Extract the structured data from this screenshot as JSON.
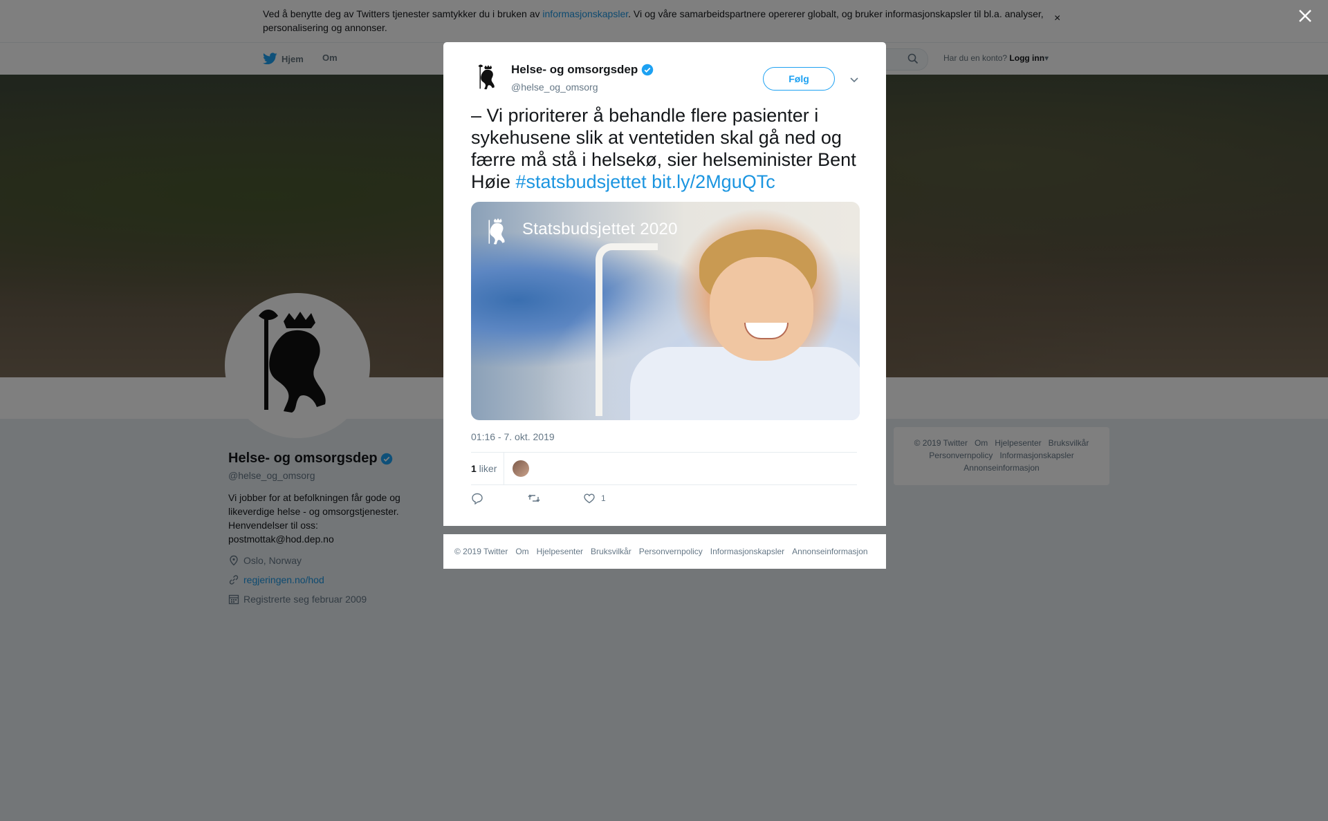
{
  "cookie_banner": {
    "text_before": "Ved å benytte deg av Twitters tjenester samtykker du i bruken av ",
    "link": "informasjonskapsler",
    "text_after": ". Vi og våre samarbeidspartnere opererer globalt, og bruker informasjonskapsler til bl.a. analyser, personalisering og annonser.",
    "close": "×"
  },
  "topnav": {
    "home": "Hjem",
    "about": "Om",
    "account_prompt": "Har du en konto?",
    "login": "Logg inn"
  },
  "profile": {
    "name": "Helse- og omsorgsdep",
    "handle": "@helse_og_omsorg",
    "bio": "Vi jobber for at befolkningen får gode og likeverdige helse - og omsorgstjenester. Henvendelser til oss: postmottak@hod.dep.no",
    "location": "Oslo, Norway",
    "website": "regjeringen.no/hod",
    "joined": "Registrerte seg februar 2009"
  },
  "side_footer": {
    "links_row1": [
      "© 2019 Twitter",
      "Om",
      "Hjelpesenter",
      "Bruksvilkår"
    ],
    "links_row2": [
      "Personvernpolicy",
      "Informasjonskapsler"
    ],
    "links_row3": [
      "Annonseinformasjon"
    ]
  },
  "tweet": {
    "author_name": "Helse- og omsorgsdep",
    "author_handle": "@helse_og_omsorg",
    "follow_label": "Følg",
    "text": "– Vi prioriterer å behandle flere pasienter i sykehusene slik at ventetiden skal gå ned og færre må stå i helsekø, sier helseminister Bent Høie ",
    "hashtag": "#statsbudsjettet",
    "link": "bit.ly/2MguQTc",
    "media_caption": "Statsbudsjettet 2020",
    "timestamp": "01:16 - 7. okt. 2019",
    "likes_count": "1",
    "likes_label": " liker",
    "like_action_count": "1"
  },
  "modal_footer": {
    "links": [
      "© 2019 Twitter",
      "Om",
      "Hjelpesenter",
      "Bruksvilkår",
      "Personvernpolicy",
      "Informasjonskapsler",
      "Annonseinformasjon"
    ]
  },
  "colors": {
    "accent": "#1da1f2",
    "link": "#1b95e0",
    "muted": "#657786",
    "overlay": "rgba(0,0,0,0.5)"
  }
}
